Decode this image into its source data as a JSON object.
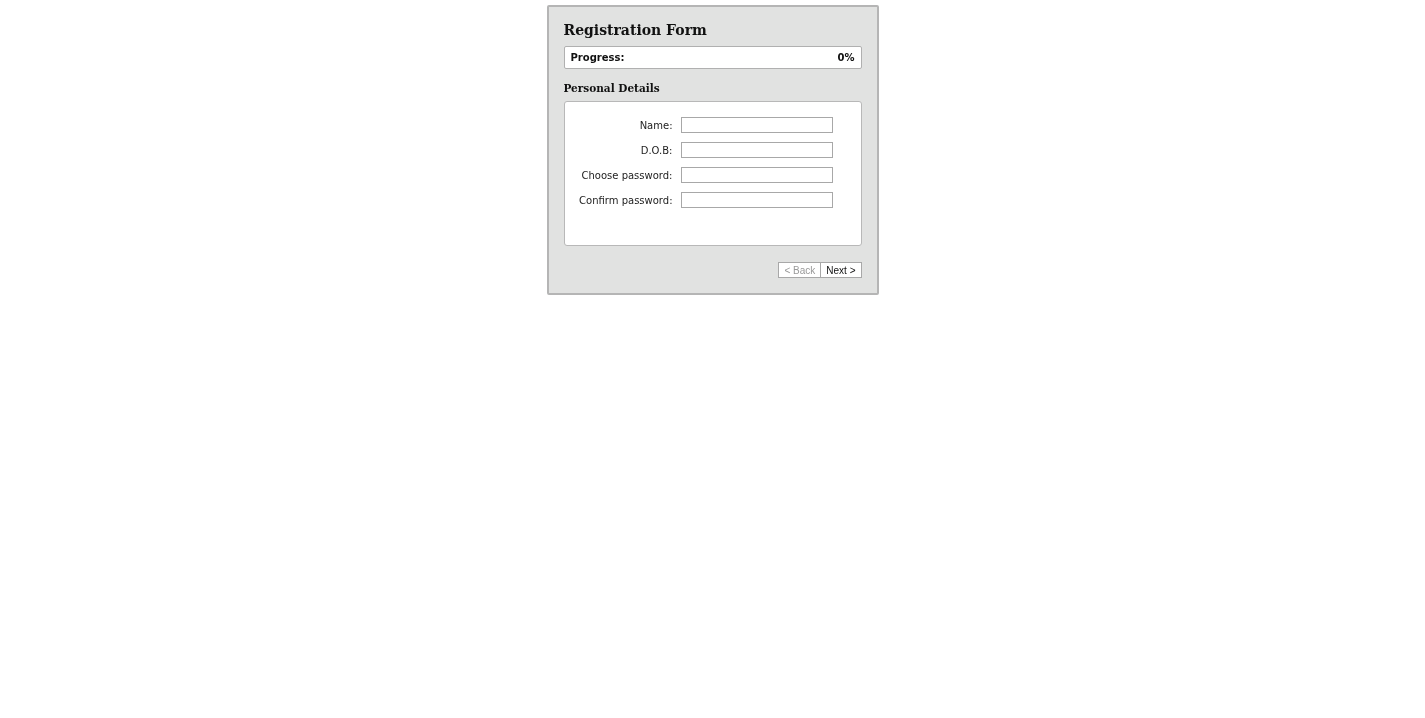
{
  "title": "Registration Form",
  "progress": {
    "label": "Progress:",
    "reading": "0%"
  },
  "section": {
    "title": "Personal Details"
  },
  "fields": [
    {
      "label": "Name:"
    },
    {
      "label": "D.O.B:"
    },
    {
      "label": "Choose password:"
    },
    {
      "label": "Confirm password:"
    }
  ],
  "buttons": [
    {
      "label": "< Back",
      "disabled": true
    },
    {
      "label": "Next >",
      "disabled": false
    }
  ]
}
